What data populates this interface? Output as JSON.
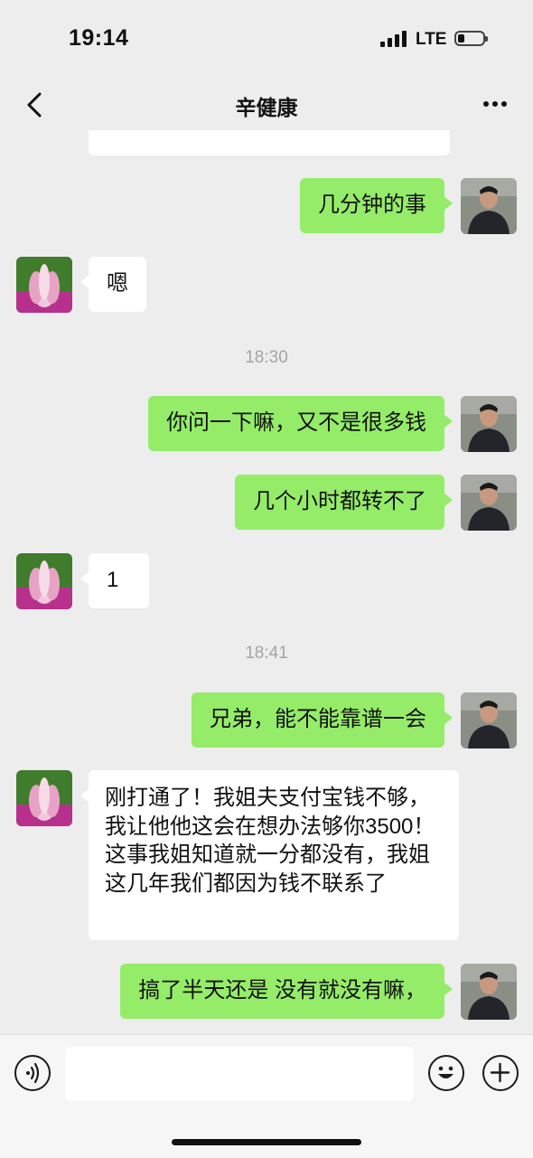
{
  "status": {
    "time": "19:14",
    "network": "LTE"
  },
  "nav": {
    "title": "辛健康",
    "back_icon": "chevron-left-icon",
    "more_icon": "more-dots-icon"
  },
  "messages": [
    {
      "type": "in",
      "text": ""
    },
    {
      "type": "out",
      "text": "几分钟的事"
    },
    {
      "type": "in",
      "text": "嗯"
    },
    {
      "type": "time",
      "text": "18:30"
    },
    {
      "type": "out",
      "text": "你问一下嘛，又不是很多钱"
    },
    {
      "type": "out",
      "text": "几个小时都转不了"
    },
    {
      "type": "in",
      "text": "1"
    },
    {
      "type": "time",
      "text": "18:41"
    },
    {
      "type": "out",
      "text": "兄弟，能不能靠谱一会"
    },
    {
      "type": "in",
      "text": "刚打通了！我姐夫支付宝钱不够，我让他他这会在想办法够你3500！这事我姐知道就一分都没有，我姐这几年我们都因为钱不联系了"
    },
    {
      "type": "out",
      "text": "搞了半天还是 没有就没有嘛，"
    }
  ],
  "input": {
    "value": "",
    "voice_icon": "voice-icon",
    "emoji_icon": "emoji-icon",
    "plus_icon": "plus-icon"
  },
  "colors": {
    "background": "#ededed",
    "outgoing_bubble": "#95ec69",
    "incoming_bubble": "#ffffff",
    "timestamp": "#a4a4a4"
  }
}
